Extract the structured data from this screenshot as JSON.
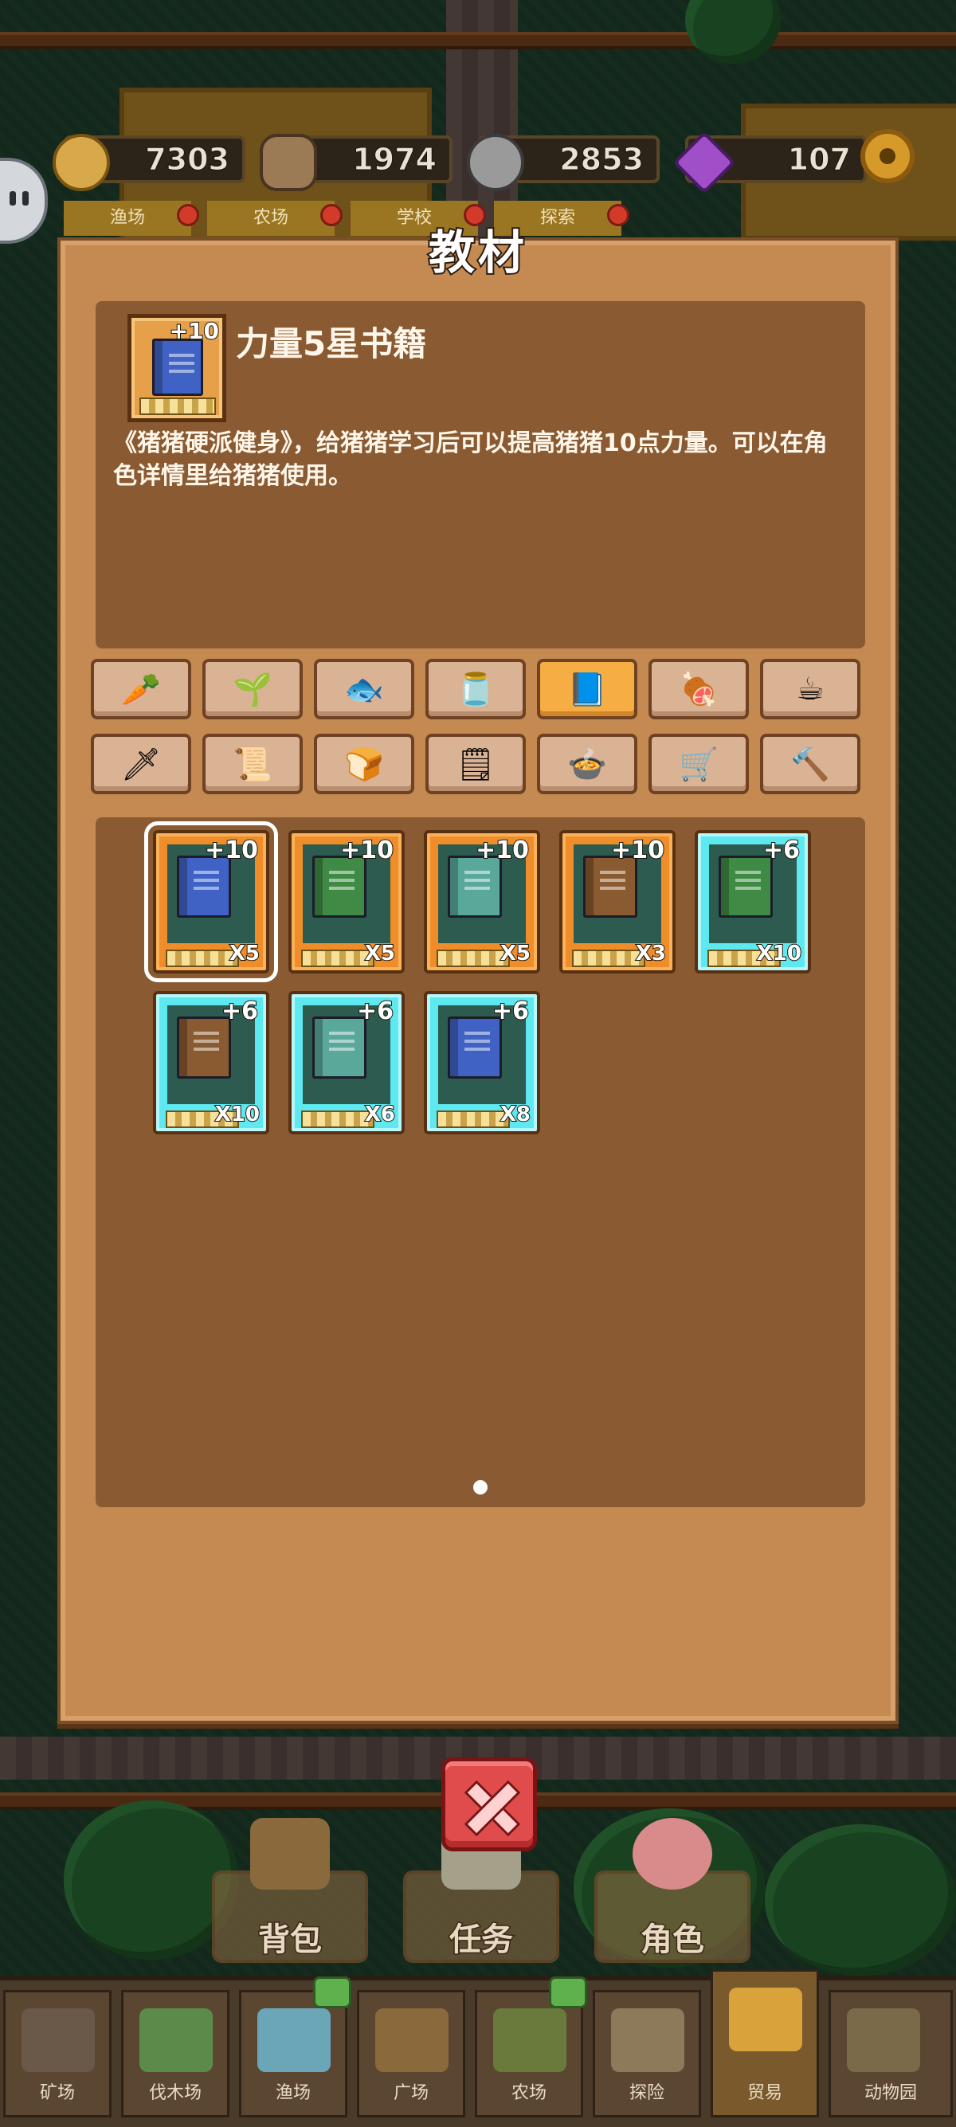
{
  "resources": [
    {
      "name": "gold",
      "icon": "coin-icon",
      "value": "7303",
      "color": "#d7a94a"
    },
    {
      "name": "wood",
      "icon": "log-icon",
      "value": "1974",
      "color": "#9b7b55"
    },
    {
      "name": "stone",
      "icon": "stone-icon",
      "value": "2853",
      "color": "#9a9a9a"
    },
    {
      "name": "gems",
      "icon": "gem-icon",
      "value": "107",
      "color": "#a04fc8"
    }
  ],
  "subtabs": [
    "渔场",
    "农场",
    "学校",
    "探索"
  ],
  "dialog": {
    "title": "教材",
    "selected_item": {
      "level_badge": "+10",
      "name": "力量5星书籍",
      "description": "《猪猪硬派健身》，给猪猪学习后可以提高猪猪10点力量。可以在角色详情里给猪猪使用。"
    },
    "categories": [
      {
        "icon": "carrot-icon",
        "glyph": "🥕",
        "active": false
      },
      {
        "icon": "seed-packet-icon",
        "glyph": "🌱",
        "active": false
      },
      {
        "icon": "fish-icon",
        "glyph": "🐟",
        "active": false
      },
      {
        "icon": "fish-tank-icon",
        "glyph": "🫙",
        "active": false
      },
      {
        "icon": "book-icon",
        "glyph": "📘",
        "active": true
      },
      {
        "icon": "meat-icon",
        "glyph": "🍖",
        "active": false
      },
      {
        "icon": "coffee-cup-icon",
        "glyph": "☕",
        "active": false
      },
      {
        "icon": "sword-icon",
        "glyph": "🗡",
        "active": false
      },
      {
        "icon": "scroll-icon",
        "glyph": "📜",
        "active": false
      },
      {
        "icon": "bread-icon",
        "glyph": "🍞",
        "active": false
      },
      {
        "icon": "blueprint-icon",
        "glyph": "🗒",
        "active": false
      },
      {
        "icon": "dish-icon",
        "glyph": "🍲",
        "active": false
      },
      {
        "icon": "ore-cart-icon",
        "glyph": "🛒",
        "active": false
      },
      {
        "icon": "hammer-icon",
        "glyph": "🔨",
        "active": false
      }
    ],
    "items": [
      {
        "plus": "+10",
        "count": "X5",
        "rarity": "orange",
        "book_color": "#3f62c4",
        "selected": true
      },
      {
        "plus": "+10",
        "count": "X5",
        "rarity": "orange",
        "book_color": "#3f8a44",
        "selected": false
      },
      {
        "plus": "+10",
        "count": "X5",
        "rarity": "orange",
        "book_color": "#5aa89a",
        "selected": false
      },
      {
        "plus": "+10",
        "count": "X3",
        "rarity": "orange",
        "book_color": "#8a5a30",
        "selected": false
      },
      {
        "plus": "+6",
        "count": "X10",
        "rarity": "cyan",
        "book_color": "#3f8a44",
        "selected": false
      },
      {
        "plus": "+6",
        "count": "X10",
        "rarity": "cyan",
        "book_color": "#8a5a30",
        "selected": false
      },
      {
        "plus": "+6",
        "count": "X6",
        "rarity": "cyan",
        "book_color": "#5aa89a",
        "selected": false
      },
      {
        "plus": "+6",
        "count": "X8",
        "rarity": "cyan",
        "book_color": "#3f62c4",
        "selected": false
      }
    ]
  },
  "dock": [
    {
      "label": "背包",
      "icon": "backpack-icon"
    },
    {
      "label": "任务",
      "icon": "quest-board-icon"
    },
    {
      "label": "角色",
      "icon": "pig-face-icon"
    }
  ],
  "nav": [
    {
      "label": "矿场",
      "icon": "mine-cart-icon",
      "active": false,
      "bubble": false
    },
    {
      "label": "伐木场",
      "icon": "lumber-icon",
      "active": false,
      "bubble": false
    },
    {
      "label": "渔场",
      "icon": "fishing-icon",
      "active": false,
      "bubble": true
    },
    {
      "label": "广场",
      "icon": "plaza-icon",
      "active": false,
      "bubble": false
    },
    {
      "label": "农场",
      "icon": "sprout-icon",
      "active": false,
      "bubble": true
    },
    {
      "label": "探险",
      "icon": "explore-icon",
      "active": false,
      "bubble": false
    },
    {
      "label": "贸易",
      "icon": "trade-stall-icon",
      "active": true,
      "bubble": false
    },
    {
      "label": "动物园",
      "icon": "zoo-icon",
      "active": false,
      "bubble": false
    }
  ]
}
